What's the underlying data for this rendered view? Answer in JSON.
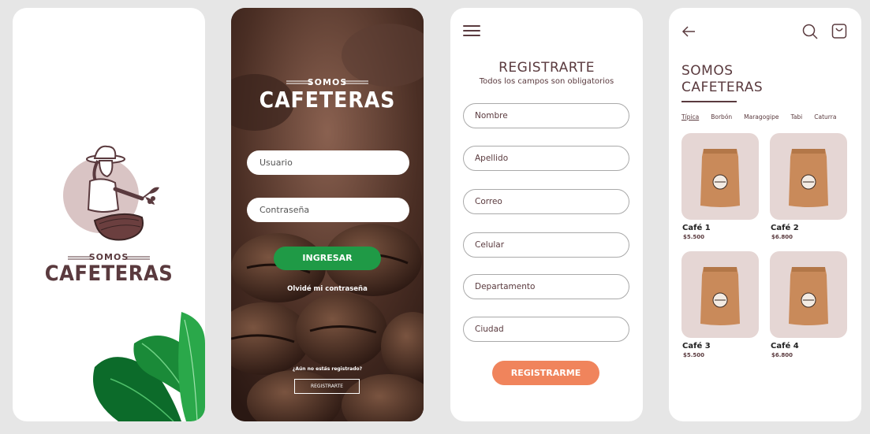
{
  "splash": {
    "brand_small": "SOMOS",
    "brand_big": "CAFETERAS"
  },
  "login": {
    "brand_small": "SOMOS",
    "brand_big": "CAFETERAS",
    "username_placeholder": "Usuario",
    "password_placeholder": "Contraseña",
    "login_button": "INGRESAR",
    "forgot_password": "Olvidé mi contraseña",
    "not_registered": "¿Aún no estás registrado?",
    "register_button": "REGISTRARTE"
  },
  "register": {
    "title": "REGISTRARTE",
    "subtitle": "Todos los campos son obligatorios",
    "fields": [
      "Nombre",
      "Apellido",
      "Correo",
      "Celular",
      "Departamento",
      "Ciudad"
    ],
    "submit": "REGISTRARME"
  },
  "catalog": {
    "title_line1": "SOMOS",
    "title_line2": "CAFETERAS",
    "tabs": [
      "Típica",
      "Borbón",
      "Maragogipe",
      "Tabi",
      "Caturra"
    ],
    "products": [
      {
        "name": "Café 1",
        "price": "$5.500"
      },
      {
        "name": "Café 2",
        "price": "$6.800"
      },
      {
        "name": "Café 3",
        "price": "$5.500"
      },
      {
        "name": "Café 4",
        "price": "$6.800"
      }
    ]
  },
  "colors": {
    "brand_brown": "#5a3a3e",
    "login_green": "#1f9a46",
    "register_orange": "#f0845c",
    "card_bg": "#e5d6d4"
  }
}
